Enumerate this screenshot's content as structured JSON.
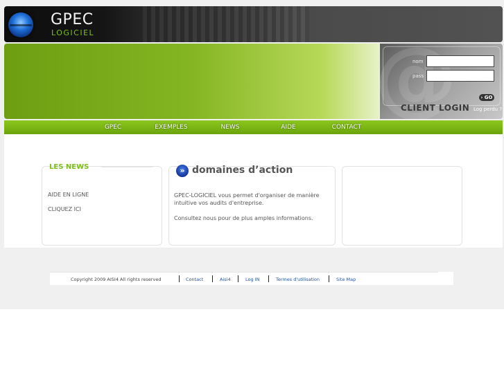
{
  "header": {
    "title": "GPEC",
    "subtitle": "LOGICIEL"
  },
  "login": {
    "nom_label": "nom",
    "pass_label": "pass",
    "go_label": "› GO",
    "client_login": "CLIENT LOGIN",
    "lost_link": "Log perdu ?"
  },
  "nav": [
    "GPEC",
    "EXEMPLES",
    "NEWS",
    "AIDE",
    "CONTACT"
  ],
  "news": {
    "title": "LES NEWS",
    "links": [
      "AIDE EN LIGNE",
      "CLIQUEZ ICI"
    ]
  },
  "domaines": {
    "title": "domaines d’action",
    "paragraph1": "GPEC-LOGICIEL vous permet d'organiser de manière intuitive vos audits d'entreprise.",
    "paragraph2": "Consultez nous pour de plus amples informations."
  },
  "footer": {
    "copyright": "Copyright 2009 AISI4  All rights reserved",
    "links": [
      "Contact",
      "Aisi4",
      "Log IN",
      "Termes d'utilisation",
      "Site Map"
    ]
  }
}
